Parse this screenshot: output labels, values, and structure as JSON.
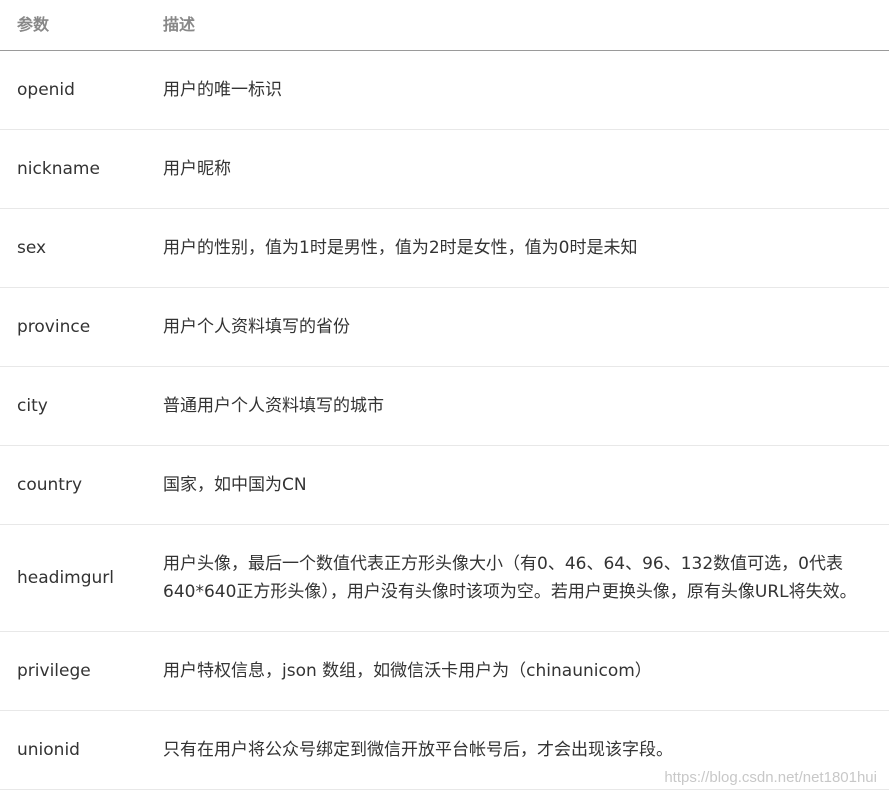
{
  "header": {
    "param": "参数",
    "desc": "描述"
  },
  "rows": [
    {
      "param": "openid",
      "desc": "用户的唯一标识"
    },
    {
      "param": "nickname",
      "desc": "用户昵称"
    },
    {
      "param": "sex",
      "desc": "用户的性别，值为1时是男性，值为2时是女性，值为0时是未知"
    },
    {
      "param": "province",
      "desc": "用户个人资料填写的省份"
    },
    {
      "param": "city",
      "desc": "普通用户个人资料填写的城市"
    },
    {
      "param": "country",
      "desc": "国家，如中国为CN"
    },
    {
      "param": "headimgurl",
      "desc": "用户头像，最后一个数值代表正方形头像大小（有0、46、64、96、132数值可选，0代表640*640正方形头像），用户没有头像时该项为空。若用户更换头像，原有头像URL将失效。"
    },
    {
      "param": "privilege",
      "desc": "用户特权信息，json 数组，如微信沃卡用户为（chinaunicom）"
    },
    {
      "param": "unionid",
      "desc": "只有在用户将公众号绑定到微信开放平台帐号后，才会出现该字段。"
    }
  ],
  "watermark": "https://blog.csdn.net/net1801hui"
}
